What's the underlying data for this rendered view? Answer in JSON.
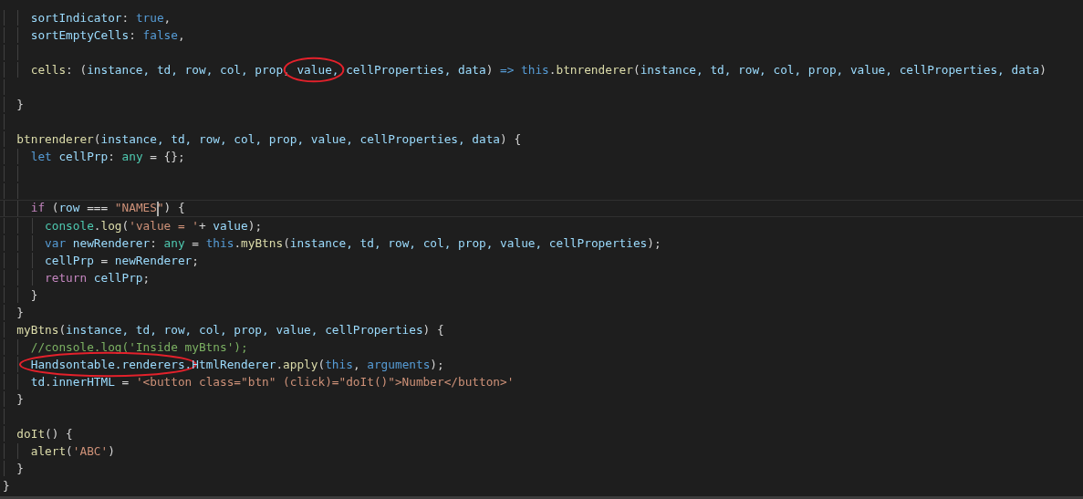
{
  "editor": {
    "lines": [
      {
        "kind": "code",
        "tokens": [
          {
            "text": "    sortIndicator",
            "kind": "var"
          },
          {
            "text": ": ",
            "kind": "plain"
          },
          {
            "text": "true",
            "kind": "keyword"
          },
          {
            "text": ",",
            "kind": "plain"
          }
        ]
      },
      {
        "kind": "code",
        "tokens": [
          {
            "text": "    sortEmptyCells",
            "kind": "var"
          },
          {
            "text": ": ",
            "kind": "plain"
          },
          {
            "text": "false",
            "kind": "keyword"
          },
          {
            "text": ",",
            "kind": "plain"
          }
        ]
      },
      {
        "kind": "blank"
      },
      {
        "kind": "code",
        "tokens": [
          {
            "text": "    cells",
            "kind": "func"
          },
          {
            "text": ": (",
            "kind": "plain"
          },
          {
            "text": "instance, td, row, col, prop",
            "kind": "var"
          },
          {
            "text": ", ",
            "kind": "plain"
          },
          {
            "text": "value,",
            "kind": "var",
            "circled": true
          },
          {
            "text": " cellProperties, data",
            "kind": "var"
          },
          {
            "text": ") ",
            "kind": "plain"
          },
          {
            "text": "=> this",
            "kind": "keyword"
          },
          {
            "text": ".",
            "kind": "plain"
          },
          {
            "text": "btnrenderer",
            "kind": "func"
          },
          {
            "text": "(",
            "kind": "plain"
          },
          {
            "text": "instance, td, row, col, prop, value, cellProperties, data",
            "kind": "var"
          },
          {
            "text": ")",
            "kind": "plain"
          }
        ]
      },
      {
        "kind": "blank"
      },
      {
        "kind": "code",
        "tokens": [
          {
            "text": "  }",
            "kind": "plain"
          }
        ]
      },
      {
        "kind": "blank"
      },
      {
        "kind": "code",
        "tokens": [
          {
            "text": "  btnrenderer",
            "kind": "func"
          },
          {
            "text": "(",
            "kind": "plain"
          },
          {
            "text": "instance, td, row, col, prop, value, cellProperties, data",
            "kind": "var"
          },
          {
            "text": ") {",
            "kind": "plain"
          }
        ]
      },
      {
        "kind": "code",
        "tokens": [
          {
            "text": "    let",
            "kind": "keyword"
          },
          {
            "text": " cellPrp",
            "kind": "var"
          },
          {
            "text": ": ",
            "kind": "plain"
          },
          {
            "text": "any",
            "kind": "type"
          },
          {
            "text": " = {};",
            "kind": "plain"
          }
        ]
      },
      {
        "kind": "blank"
      },
      {
        "kind": "blank"
      },
      {
        "kind": "code",
        "current": true,
        "tokens": [
          {
            "text": "    if",
            "kind": "control"
          },
          {
            "text": " (",
            "kind": "plain"
          },
          {
            "text": "row",
            "kind": "var"
          },
          {
            "text": " === ",
            "kind": "plain"
          },
          {
            "text": "\"NAMES",
            "kind": "string",
            "caret_after": true
          },
          {
            "text": "\"",
            "kind": "string"
          },
          {
            "text": ") {",
            "kind": "plain"
          }
        ]
      },
      {
        "kind": "code",
        "tokens": [
          {
            "text": "      console",
            "kind": "type"
          },
          {
            "text": ".",
            "kind": "plain"
          },
          {
            "text": "log",
            "kind": "func"
          },
          {
            "text": "(",
            "kind": "plain"
          },
          {
            "text": "'value = '",
            "kind": "string"
          },
          {
            "text": "+ ",
            "kind": "plain"
          },
          {
            "text": "value",
            "kind": "var"
          },
          {
            "text": ");",
            "kind": "plain"
          }
        ]
      },
      {
        "kind": "code",
        "tokens": [
          {
            "text": "      var",
            "kind": "keyword"
          },
          {
            "text": " newRenderer",
            "kind": "var"
          },
          {
            "text": ": ",
            "kind": "plain"
          },
          {
            "text": "any",
            "kind": "type"
          },
          {
            "text": " = ",
            "kind": "plain"
          },
          {
            "text": "this",
            "kind": "keyword"
          },
          {
            "text": ".",
            "kind": "plain"
          },
          {
            "text": "myBtns",
            "kind": "func"
          },
          {
            "text": "(",
            "kind": "plain"
          },
          {
            "text": "instance, td, row, col, prop, value, cellProperties",
            "kind": "var"
          },
          {
            "text": ");",
            "kind": "plain"
          }
        ]
      },
      {
        "kind": "code",
        "tokens": [
          {
            "text": "      cellPrp",
            "kind": "var"
          },
          {
            "text": " = ",
            "kind": "plain"
          },
          {
            "text": "newRenderer",
            "kind": "var"
          },
          {
            "text": ";",
            "kind": "plain"
          }
        ]
      },
      {
        "kind": "code",
        "tokens": [
          {
            "text": "      return",
            "kind": "control"
          },
          {
            "text": " cellPrp",
            "kind": "var"
          },
          {
            "text": ";",
            "kind": "plain"
          }
        ]
      },
      {
        "kind": "code",
        "tokens": [
          {
            "text": "    }",
            "kind": "plain"
          }
        ]
      },
      {
        "kind": "code",
        "tokens": [
          {
            "text": "  }",
            "kind": "plain"
          }
        ]
      },
      {
        "kind": "code",
        "tokens": [
          {
            "text": "  myBtns",
            "kind": "func"
          },
          {
            "text": "(",
            "kind": "plain"
          },
          {
            "text": "instance, td, row, col, prop, value, cellProperties",
            "kind": "var"
          },
          {
            "text": ") {",
            "kind": "plain"
          }
        ]
      },
      {
        "kind": "code",
        "tokens": [
          {
            "text": "    //console.log('Inside myBtns');",
            "kind": "comment"
          }
        ]
      },
      {
        "kind": "code",
        "tokens": [
          {
            "text": "    Handsontable.renderers.",
            "kind": "var",
            "circled": true
          },
          {
            "text": "HtmlRenderer",
            "kind": "var"
          },
          {
            "text": ".",
            "kind": "plain"
          },
          {
            "text": "apply",
            "kind": "func"
          },
          {
            "text": "(",
            "kind": "plain"
          },
          {
            "text": "this",
            "kind": "keyword"
          },
          {
            "text": ", ",
            "kind": "plain"
          },
          {
            "text": "arguments",
            "kind": "keyword"
          },
          {
            "text": ");",
            "kind": "plain"
          }
        ]
      },
      {
        "kind": "code",
        "tokens": [
          {
            "text": "    td",
            "kind": "var"
          },
          {
            "text": ".",
            "kind": "plain"
          },
          {
            "text": "innerHTML",
            "kind": "var"
          },
          {
            "text": " = ",
            "kind": "plain"
          },
          {
            "text": "'<button class=\"btn\" (click)=\"doIt()\">Number</button>'",
            "kind": "string"
          }
        ]
      },
      {
        "kind": "code",
        "tokens": [
          {
            "text": "  }",
            "kind": "plain"
          }
        ]
      },
      {
        "kind": "blank"
      },
      {
        "kind": "code",
        "tokens": [
          {
            "text": "  doIt",
            "kind": "func"
          },
          {
            "text": "() {",
            "kind": "plain"
          }
        ]
      },
      {
        "kind": "code",
        "tokens": [
          {
            "text": "    alert",
            "kind": "func"
          },
          {
            "text": "(",
            "kind": "plain"
          },
          {
            "text": "'ABC'",
            "kind": "string"
          },
          {
            "text": ")",
            "kind": "plain"
          }
        ]
      },
      {
        "kind": "code",
        "tokens": [
          {
            "text": "  }",
            "kind": "plain"
          }
        ]
      },
      {
        "kind": "code",
        "tokens": [
          {
            "text": "}",
            "kind": "plain"
          }
        ]
      }
    ]
  }
}
